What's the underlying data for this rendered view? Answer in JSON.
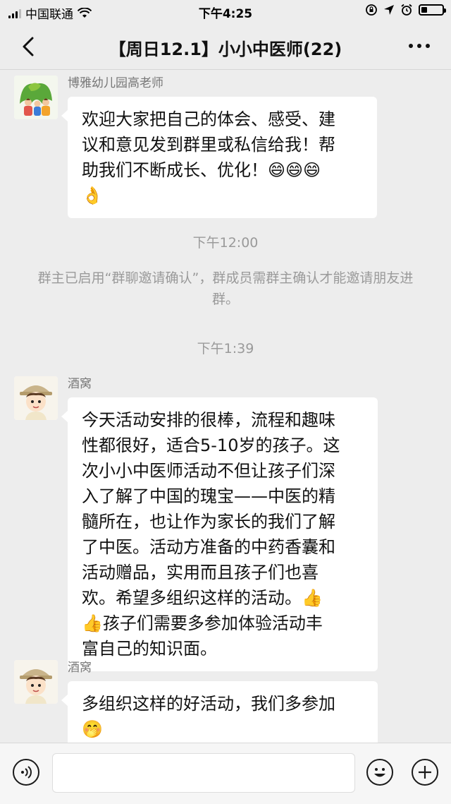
{
  "status_bar": {
    "carrier": "中国联通",
    "time": "下午4:25",
    "battery_level": 0.3,
    "icons": [
      "signal-icon",
      "wifi-icon",
      "orientation-lock-icon",
      "location-icon",
      "alarm-icon",
      "battery-icon"
    ]
  },
  "nav": {
    "back_icon": "chevron-left-icon",
    "title": "【周日12.1】小小中医师(22)",
    "more_icon": "more-dots-icon"
  },
  "messages": [
    {
      "sender": "博雅幼儿园高老师",
      "text": "欢迎大家把自己的体会、感受、建\n议和意见发到群里或私信给我！帮\n助我们不断成长、优化！😄😄😄\n👌"
    },
    {
      "sender": "酒窝",
      "text": "今天活动安排的很棒，流程和趣味\n性都很好，适合5-10岁的孩子。这\n次小小中医师活动不但让孩子们深\n入了解了中国的瑰宝——中医的精\n髓所在，也让作为家长的我们了解\n了中医。活动方准备的中药香囊和\n活动赠品，实用而且孩子们也喜\n欢。希望多组织这样的活动。👍\n👍孩子们需要多参加体验活动丰\n富自己的知识面。"
    },
    {
      "sender": "酒窝",
      "text": "多组织这样的好活动，我们多参加\n🤭"
    }
  ],
  "timestamps": [
    "下午12:00",
    "下午1:39"
  ],
  "system_notice": "群主已启用“群聊邀请确认”，群成员需群主确认才能邀请朋友进群。",
  "input_bar": {
    "placeholder": "",
    "icons": [
      "voice-icon",
      "emoji-icon",
      "plus-icon"
    ]
  }
}
